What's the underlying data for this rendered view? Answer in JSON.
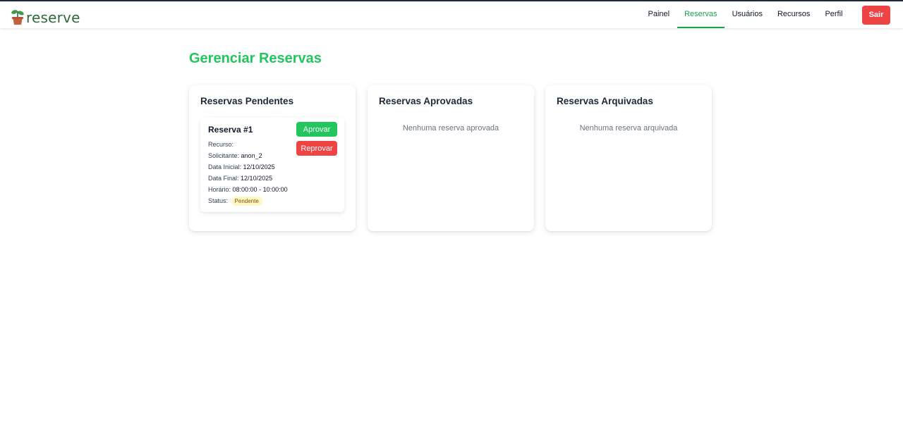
{
  "app": {
    "logo_text": "reserve"
  },
  "nav": {
    "items": [
      {
        "label": "Painel"
      },
      {
        "label": "Reservas",
        "active": true
      },
      {
        "label": "Usuários"
      },
      {
        "label": "Recursos"
      },
      {
        "label": "Perfil"
      }
    ],
    "logout_label": "Sair"
  },
  "page": {
    "title": "Gerenciar Reservas"
  },
  "columns": {
    "pending": {
      "title": "Reservas Pendentes",
      "items": [
        {
          "title": "Reserva #1",
          "resource_label": "Recurso:",
          "resource_value": "",
          "requester_label": "Solicitante:",
          "requester_value": "anon_2",
          "start_label": "Data Inicial:",
          "start_value": "12/10/2025",
          "end_label": "Data Final:",
          "end_value": "12/10/2025",
          "time_label": "Horário:",
          "time_value": "08:00:00 - 10:00:00",
          "status_label": "Status:",
          "status_value": "Pendente",
          "approve_label": "Aprovar",
          "reject_label": "Reprovar"
        }
      ]
    },
    "approved": {
      "title": "Reservas Aprovadas",
      "empty_text": "Nenhuma reserva aprovada"
    },
    "archived": {
      "title": "Reservas Arquivadas",
      "empty_text": "Nenhuma reserva arquivada"
    }
  },
  "colors": {
    "accent_green": "#22c55e",
    "danger_red": "#ef4444",
    "pending_badge_bg": "#fef9c3"
  }
}
